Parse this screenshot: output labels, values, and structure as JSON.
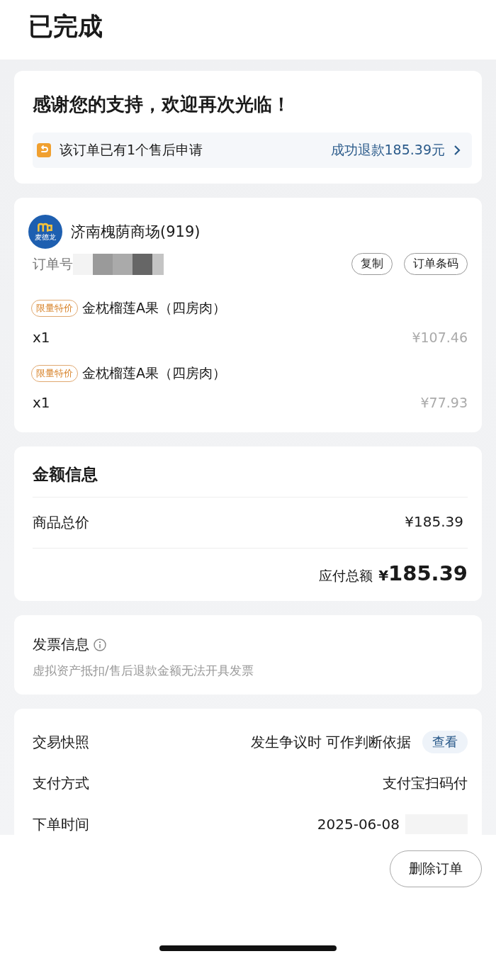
{
  "title": "已完成",
  "thanks": {
    "heading": "感谢您的支持，欢迎再次光临！",
    "after_sale": "该订单已有1个售后申请",
    "refund_link": "成功退款185.39元"
  },
  "store": {
    "logo_text": "麦德龙",
    "name": "济南槐荫商场(919)",
    "order_no_label": "订单号",
    "buttons": [
      "复制",
      "订单条码"
    ]
  },
  "items": [
    {
      "tag": "限量特价",
      "name": "金枕榴莲A果（四房肉）",
      "qty": "x1",
      "price": "¥107.46"
    },
    {
      "tag": "限量特价",
      "name": "金枕榴莲A果（四房肉）",
      "qty": "x1",
      "price": "¥77.93"
    }
  ],
  "amount": {
    "title": "金额信息",
    "rows": [
      {
        "label": "商品总价",
        "value": "¥185.39"
      }
    ],
    "total_label": "应付总额",
    "total_currency": "¥",
    "total_value": "185.39"
  },
  "invoice": {
    "title": "发票信息",
    "note": "虚拟资产抵扣/售后退款金额无法开具发票"
  },
  "details": [
    {
      "label": "交易快照",
      "value": "发生争议时 可作判断依据",
      "action": "查看",
      "redacted": false
    },
    {
      "label": "支付方式",
      "value": "支付宝扫码付",
      "redacted": false
    },
    {
      "label": "下单时间",
      "value": "2025-06-08",
      "redacted": true
    }
  ],
  "delete_button": "删除订单"
}
